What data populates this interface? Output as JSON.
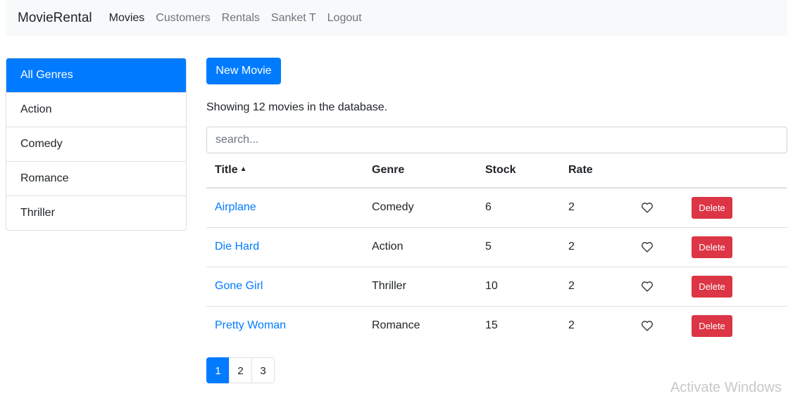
{
  "navbar": {
    "brand": "MovieRental",
    "links": [
      "Movies",
      "Customers",
      "Rentals",
      "Sanket T",
      "Logout"
    ]
  },
  "genres": [
    "All Genres",
    "Action",
    "Comedy",
    "Romance",
    "Thriller"
  ],
  "new_movie_label": "New Movie",
  "count_text": "Showing 12 movies in the database.",
  "search": {
    "placeholder": "search..."
  },
  "table": {
    "headers": [
      "Title",
      "Genre",
      "Stock",
      "Rate"
    ],
    "delete_label": "Delete",
    "rows": [
      {
        "title": "Airplane",
        "genre": "Comedy",
        "stock": "6",
        "rate": "2"
      },
      {
        "title": "Die Hard",
        "genre": "Action",
        "stock": "5",
        "rate": "2"
      },
      {
        "title": "Gone Girl",
        "genre": "Thriller",
        "stock": "10",
        "rate": "2"
      },
      {
        "title": "Pretty Woman",
        "genre": "Romance",
        "stock": "15",
        "rate": "2"
      }
    ]
  },
  "pagination": [
    "1",
    "2",
    "3"
  ],
  "watermark": "Activate Windows",
  "colors": {
    "primary": "#007bff",
    "danger": "#dc3545",
    "navbar_bg": "#f8f9fa"
  }
}
